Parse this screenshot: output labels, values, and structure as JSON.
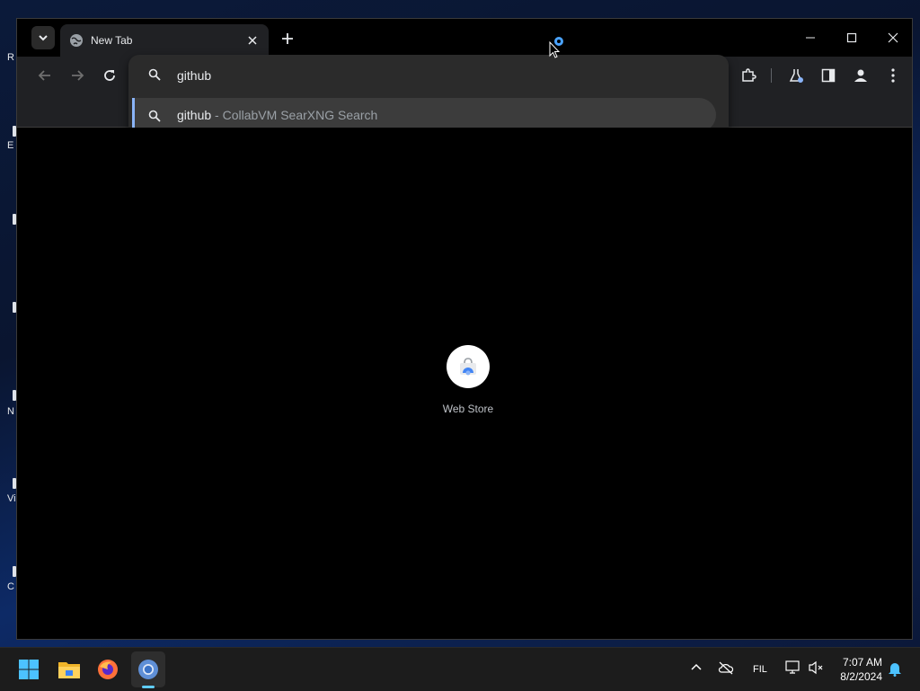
{
  "browser": {
    "tab": {
      "title": "New Tab"
    },
    "omnibox": {
      "query": "github",
      "suggestion": {
        "query": "github",
        "separator": " - ",
        "engine": "CollabVM SearXNG Search"
      }
    }
  },
  "new_tab_page": {
    "shortcuts": [
      {
        "label": "Web Store",
        "icon": "web-store-icon"
      }
    ]
  },
  "taskbar": {
    "apps": [
      "windows-start-icon",
      "file-explorer-icon",
      "firefox-icon",
      "chrome-icon"
    ],
    "language": "FIL",
    "time": "7:07 AM",
    "date": "8/2/2024"
  },
  "colors": {
    "accent": "#8ab4f8",
    "taskbar_indicator": "#60cdff"
  }
}
